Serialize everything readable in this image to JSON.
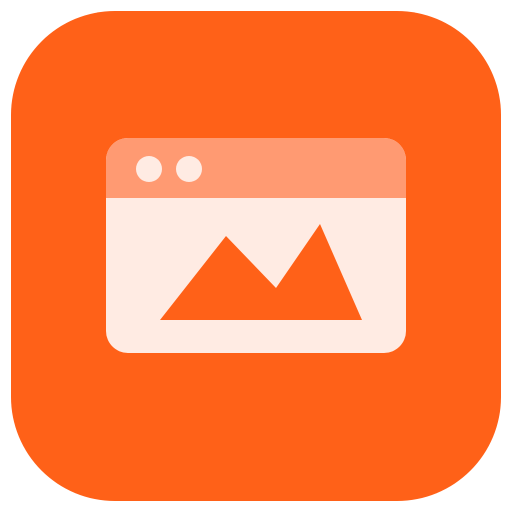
{
  "app_icon": {
    "icon": "image-window-icon",
    "colors": {
      "tile": "#FF6118",
      "window_body": "#FFEBE3",
      "title_bar": "#FF9A72",
      "window_controls": "#FFEBE3",
      "mountains": "#FF6118"
    }
  }
}
